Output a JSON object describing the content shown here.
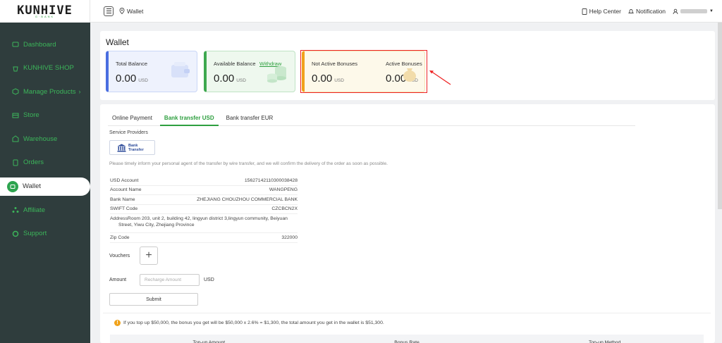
{
  "app": {
    "logo": "KUNHIVE",
    "logo_sub": "G·BANK"
  },
  "sidebar": {
    "items": [
      {
        "label": "Dashboard",
        "icon": "dashboard-icon"
      },
      {
        "label": "KUNHIVE SHOP",
        "icon": "shop-icon"
      },
      {
        "label": "Manage Products",
        "icon": "box-icon",
        "chevron": "›"
      },
      {
        "label": "Store",
        "icon": "store-icon"
      },
      {
        "label": "Warehouse",
        "icon": "warehouse-icon"
      },
      {
        "label": "Orders",
        "icon": "orders-icon"
      },
      {
        "label": "Wallet",
        "icon": "wallet-icon",
        "active": true
      },
      {
        "label": "Affiliate",
        "icon": "affiliate-icon"
      },
      {
        "label": "Support",
        "icon": "support-icon"
      }
    ]
  },
  "topbar": {
    "breadcrumb": "Wallet",
    "help": "Help Center",
    "notification": "Notification"
  },
  "wallet": {
    "title": "Wallet",
    "total": {
      "label": "Total Balance",
      "value": "0.00",
      "unit": "USD"
    },
    "available": {
      "label": "Available Balance",
      "withdraw": "Withdraw",
      "value": "0.00",
      "unit": "USD"
    },
    "not_active": {
      "label": "Not Active Bonuses",
      "value": "0.00",
      "unit": "USD"
    },
    "active": {
      "label": "Active Bonuses",
      "value": "0.00",
      "unit": "USD"
    }
  },
  "payment": {
    "tabs": [
      "Online Payment",
      "Bank transfer USD",
      "Bank transfer EUR"
    ],
    "active_tab": 1,
    "service_providers": "Service Providers",
    "bank_label_1": "Bank",
    "bank_label_2": "Transfer",
    "notice": "Please timely inform your personal agent of the transfer by wire transfer, and we will confirm the delivery of the order as soon as possible.",
    "info": {
      "usd_account_k": "USD Account",
      "usd_account_v": "15627142110300038428",
      "account_name_k": "Account Name",
      "account_name_v": "WANGPENG",
      "bank_name_k": "Bank Name",
      "bank_name_v": "ZHEJIANG CHOUZHOU COMMERCIAL BANK",
      "swift_k": "SWIFT Code",
      "swift_v": "CZCBCN2X",
      "address_1": "AddressRoom 203, unit 2, building 42, lingyun district 3,lingyun community, Beiyuan",
      "address_2": "Street, Yiwu City, Zhejiang Province",
      "zip_k": "Zip Code",
      "zip_v": "322000"
    },
    "vouchers": "Vouchers",
    "amount": "Amount",
    "amount_placeholder": "Recharge Amount",
    "currency": "USD",
    "submit": "Submit"
  },
  "bonus": {
    "note": "If you top up $50,000, the bonus you get will be $50,000 x 2.6% = $1,300, the total amount you get in the wallet is $51,300.",
    "columns": [
      "Top-up Amount",
      "Bonus Rate",
      "Top-up Method"
    ]
  },
  "colors": {
    "accent": "#2e9f3f",
    "sidebar": "#2f3d3d",
    "highlight": "#e22222"
  }
}
